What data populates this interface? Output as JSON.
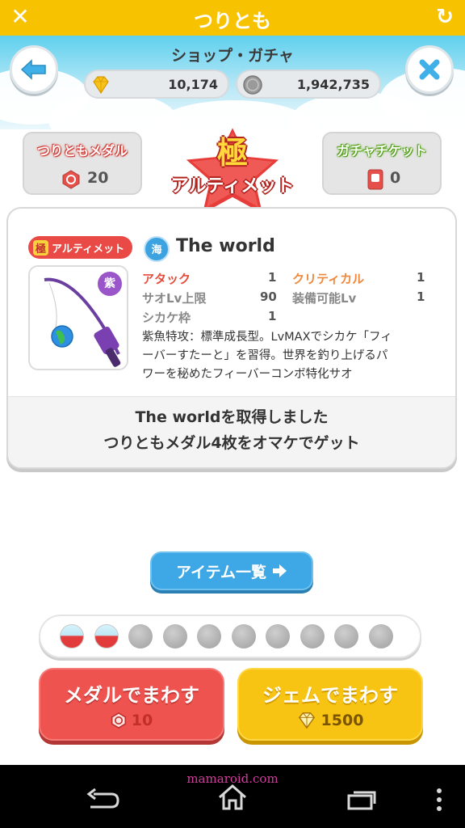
{
  "titlebar": {
    "title": "つりとも",
    "close_icon": "close-icon",
    "reload_icon": "reload-icon"
  },
  "header": {
    "shop_title": "ショップ・ガチャ",
    "gem_count": "10,174",
    "coin_count": "1,942,735"
  },
  "medal_box": {
    "label": "つりともメダル",
    "count": "20"
  },
  "ticket_box": {
    "label": "ガチャチケット",
    "count": "0"
  },
  "emblem": {
    "kanji": "極",
    "text": "アルティメット"
  },
  "card": {
    "rarity_kanji": "極",
    "rarity_text": "アルティメット",
    "sea_label": "海",
    "item_name": "The world",
    "grade_label": "紫",
    "stats": [
      {
        "label": "アタック",
        "value": "1"
      },
      {
        "label": "クリティカル",
        "value": "1"
      },
      {
        "label": "サオLv上限",
        "value": "90"
      },
      {
        "label": "装備可能Lv",
        "value": "1"
      },
      {
        "label": "シカケ枠",
        "value": "1"
      }
    ],
    "description_line1": "紫魚特攻：標準成長型。LvMAXでシカケ「フィ",
    "description_line2": "ーバーすたーと」を習得。世界を釣り上げるパ",
    "description_line3": "ワーを秘めたフィーバーコンボ特化サオ",
    "result_line1": "The worldを取得しました",
    "result_line2": "つりともメダル4枚をオマケでゲット"
  },
  "item_list_button": {
    "label": "アイテム一覧"
  },
  "gacha_progress": {
    "filled": 2,
    "total": 10
  },
  "spin_medal": {
    "label": "メダルでまわす",
    "cost": "10"
  },
  "spin_gem": {
    "label": "ジェムでまわす",
    "cost": "1500"
  },
  "watermark": "mamaroid.com",
  "colors": {
    "brand_yellow": "#f7c300",
    "red": "#ef5350",
    "blue": "#3ea8e6"
  }
}
